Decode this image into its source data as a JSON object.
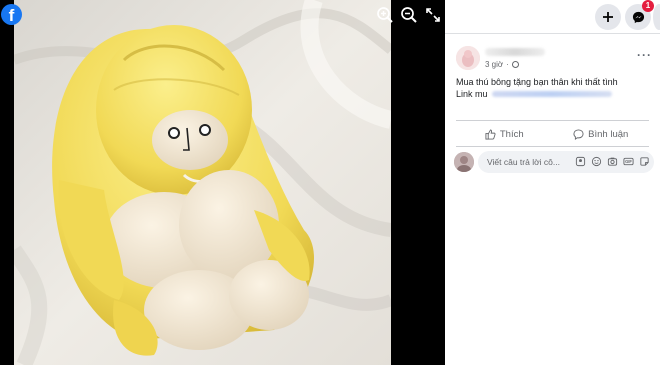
{
  "viewer": {
    "logo_letter": "f",
    "tools": [
      "zoom-in-icon",
      "zoom-out-icon",
      "fullscreen-icon"
    ]
  },
  "topbar": {
    "messenger_badge": "1"
  },
  "post": {
    "time": "3 giờ",
    "more": "···",
    "text_line1": "Mua thú bông tặng bạn thân khi thất tình",
    "text_line2_prefix": "Link mu"
  },
  "actions": {
    "like_label": "Thích",
    "comment_label": "Bình luận"
  },
  "comment": {
    "placeholder": "Viết câu trả lời cô..."
  },
  "colors": {
    "facebook_blue": "#1877f2",
    "badge_red": "#e41e3f",
    "plush_yellow": "#f3e06a"
  }
}
